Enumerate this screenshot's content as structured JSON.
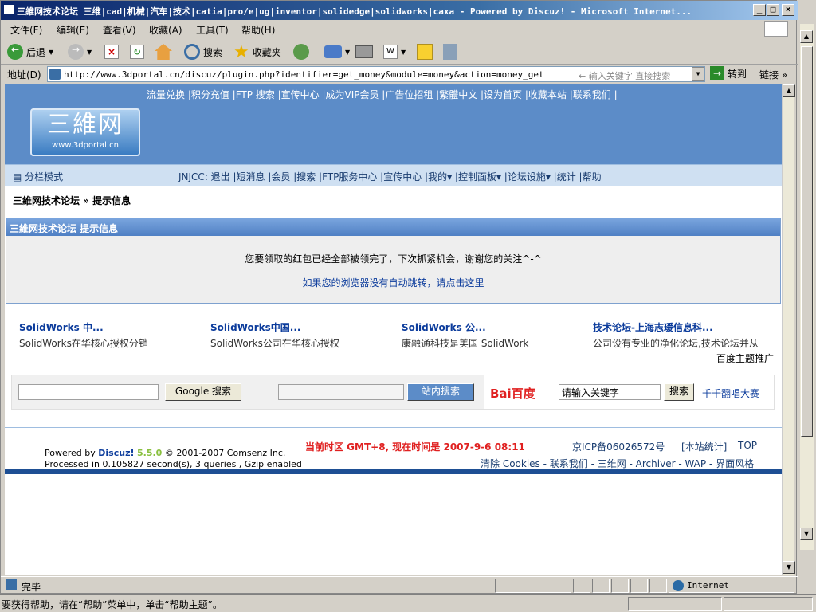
{
  "window": {
    "title": "三維网技术论坛 三维|cad|机械|汽车|技术|catia|pro/e|ug|inventor|solidedge|solidworks|caxa - Powered by Discuz! - Microsoft Internet...",
    "min": "_",
    "max": "□",
    "close": "×"
  },
  "menu": [
    "文件(F)",
    "编辑(E)",
    "查看(V)",
    "收藏(A)",
    "工具(T)",
    "帮助(H)"
  ],
  "toolbar": {
    "back": "后退",
    "search": "搜索",
    "favorites": "收藏夹"
  },
  "address": {
    "label": "地址(D)",
    "url": "http://www.3dportal.cn/discuz/plugin.php?identifier=get_money&module=money&action=money_get",
    "search_placeholder": "输入关键字 直接搜索",
    "go": "转到",
    "links": "链接"
  },
  "header": {
    "toplinks": "流量兑换 |积分充值 |FTP 搜索 |宣传中心 |成为VIP会员 |广告位招租 |繁體中文 |设为首页 |收藏本站 |联系我们 |",
    "logo_big": "三維网",
    "logo_small": "www.3dportal.cn"
  },
  "nav": {
    "layout": "分栏模式",
    "items": "JNJCC: 退出 |短消息 |会员 |搜索 |FTP服务中心 |宣传中心 |我的▾ |控制面板▾ |论坛设施▾ |统计 |帮助"
  },
  "breadcrumb": "三維网技术论坛 » 提示信息",
  "message": {
    "title": "三維网技术论坛 提示信息",
    "text": "您要领取的红包已经全部被领完了，下次抓紧机会，谢谢您的关注^-^",
    "redirect": "如果您的浏览器没有自动跳转，请点击这里"
  },
  "ads": [
    {
      "title": "SolidWorks 中...",
      "desc": "SolidWorks在华核心授权分销"
    },
    {
      "title": "SolidWorks中国...",
      "desc": "SolidWorks公司在华核心授权"
    },
    {
      "title": "SolidWorks 公...",
      "desc": "康融通科技是美国 SolidWork"
    },
    {
      "title": "技术论坛-上海志瑗信息科...",
      "desc": "公司设有专业的净化论坛,技术论坛并从"
    }
  ],
  "baidu_promo": "百度主题推广",
  "search": {
    "google_btn": "Google 搜索",
    "site_btn": "站内搜索",
    "baidu_value": "请输入关键字",
    "baidu_btn": "搜索",
    "baidu_link": "千千翻唱大赛",
    "baidu_logo": "Bai百度"
  },
  "footer": {
    "powered": "Powered by",
    "discuz": "Discuz!",
    "version": "5.5.0",
    "copyright": "© 2001-2007 Comsenz Inc.",
    "processed": "Processed in 0.105827 second(s), 3 queries , Gzip enabled",
    "time": "当前时区  GMT+8, 现在时间是  2007-9-6 08:11",
    "icp": "京ICP备06026572号",
    "stats": "[本站统计]",
    "top": "TOP",
    "links": "清除 Cookies - 联系我们 - 三维网 - Archiver - WAP - 界面风格"
  },
  "status": {
    "text": "完毕",
    "zone": "Internet"
  },
  "help": "要获得帮助，请在“帮助”菜单中，单击“帮助主题”。"
}
